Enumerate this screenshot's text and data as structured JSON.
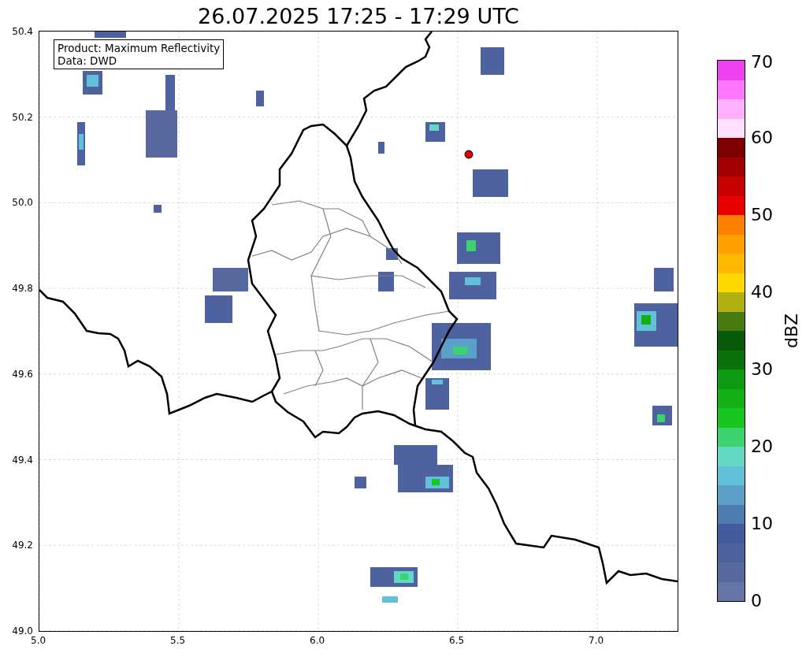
{
  "title": "26.07.2025 17:25 - 17:29 UTC",
  "legend": {
    "lines": [
      "Product: Maximum Reflectivity",
      "Data: DWD"
    ]
  },
  "map": {
    "xticks": [
      "5.0",
      "5.5",
      "6.0",
      "6.5",
      "7.0"
    ],
    "yticks": [
      "50.4",
      "50.2",
      "50.0",
      "49.8",
      "49.6",
      "49.4",
      "49.2",
      "49.0"
    ]
  },
  "colorbar": {
    "label": "dBZ",
    "ticks": [
      "70",
      "60",
      "50",
      "40",
      "30",
      "20",
      "10",
      "0"
    ],
    "segments": [
      {
        "color": "#6474a4"
      },
      {
        "color": "#58699f"
      },
      {
        "color": "#4e62a0"
      },
      {
        "color": "#445c9e"
      },
      {
        "color": "#4c7cb0"
      },
      {
        "color": "#5aa0c8"
      },
      {
        "color": "#62c0d8"
      },
      {
        "color": "#62d8c4"
      },
      {
        "color": "#3cd270"
      },
      {
        "color": "#18c620"
      },
      {
        "color": "#12b014"
      },
      {
        "color": "#0e9a10"
      },
      {
        "color": "#0a720a"
      },
      {
        "color": "#085a0a"
      },
      {
        "color": "#487a10"
      },
      {
        "color": "#b0b010"
      },
      {
        "color": "#ffd800"
      },
      {
        "color": "#ffb800"
      },
      {
        "color": "#ffa000"
      },
      {
        "color": "#ff8000"
      },
      {
        "color": "#e80000"
      },
      {
        "color": "#c80000"
      },
      {
        "color": "#a00000"
      },
      {
        "color": "#800000"
      },
      {
        "color": "#ffe0ff"
      },
      {
        "color": "#ffb0ff"
      },
      {
        "color": "#ff78ff"
      },
      {
        "color": "#f040f0"
      }
    ]
  }
}
